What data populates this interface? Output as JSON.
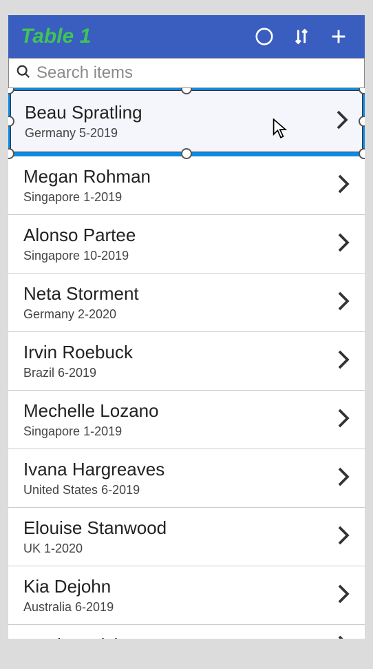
{
  "header": {
    "title": "Table 1"
  },
  "search": {
    "placeholder": "Search items",
    "value": ""
  },
  "items": [
    {
      "name": "Beau Spratling",
      "subtitle": "Germany 5-2019",
      "selected": true
    },
    {
      "name": "Megan Rohman",
      "subtitle": "Singapore 1-2019",
      "selected": false
    },
    {
      "name": "Alonso Partee",
      "subtitle": "Singapore 10-2019",
      "selected": false
    },
    {
      "name": "Neta Storment",
      "subtitle": "Germany 2-2020",
      "selected": false
    },
    {
      "name": "Irvin Roebuck",
      "subtitle": "Brazil 6-2019",
      "selected": false
    },
    {
      "name": "Mechelle Lozano",
      "subtitle": "Singapore 1-2019",
      "selected": false
    },
    {
      "name": "Ivana Hargreaves",
      "subtitle": "United States 6-2019",
      "selected": false
    },
    {
      "name": "Elouise Stanwood",
      "subtitle": "UK 1-2020",
      "selected": false
    },
    {
      "name": "Kia Dejohn",
      "subtitle": "Australia 6-2019",
      "selected": false
    },
    {
      "name": "Tamica Trickett",
      "subtitle": "",
      "selected": false,
      "partial": true
    }
  ]
}
